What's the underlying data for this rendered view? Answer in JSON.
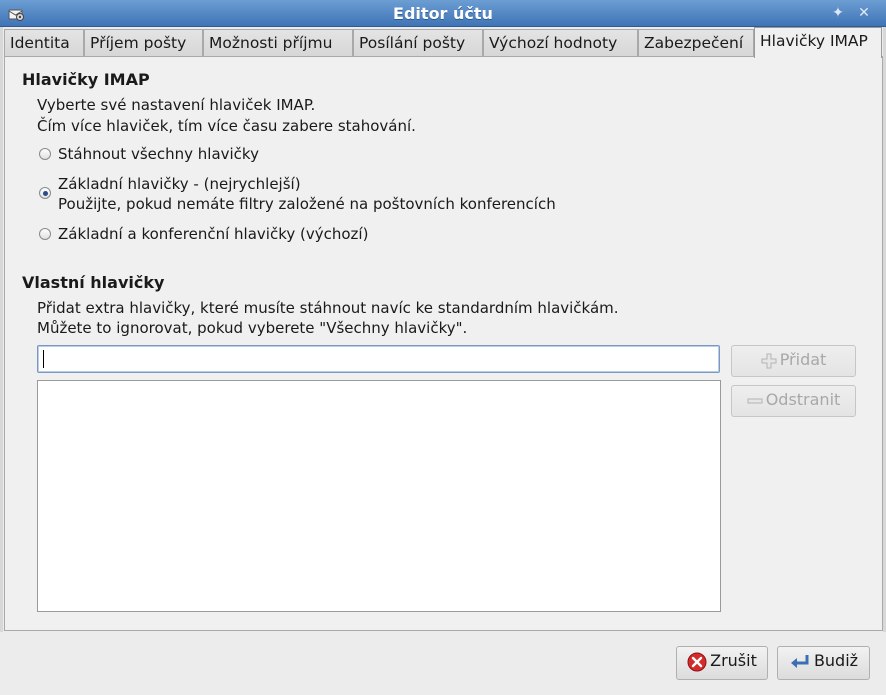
{
  "window": {
    "title": "Editor účtu",
    "pin_glyph": "✦",
    "close_glyph": "✕"
  },
  "tabs": [
    {
      "label": "Identita"
    },
    {
      "label": "Příjem pošty"
    },
    {
      "label": "Možnosti příjmu"
    },
    {
      "label": "Posílání pošty"
    },
    {
      "label": "Výchozí hodnoty"
    },
    {
      "label": "Zabezpečení"
    },
    {
      "label": "Hlavičky IMAP",
      "active": true
    }
  ],
  "imap_headers": {
    "heading": "Hlavičky IMAP",
    "description_line1": "Vyberte své nastavení hlaviček IMAP.",
    "description_line2": "Čím více hlaviček, tím více času zabere stahování.",
    "options": [
      {
        "label": "Stáhnout všechny hlavičky",
        "checked": false
      },
      {
        "label": "Základní hlavičky - (nejrychlejší)",
        "sublabel": "Použijte, pokud nemáte filtry založené na poštovních konferencích",
        "checked": true
      },
      {
        "label": "Základní a konferenční hlavičky (výchozí)",
        "checked": false
      }
    ]
  },
  "custom_headers": {
    "heading": "Vlastní hlavičky",
    "description_line1": "Přidat extra hlavičky, které musíte stáhnout navíc ke standardním hlavičkám.",
    "description_line2": "Můžete to ignorovat, pokud vyberete \"Všechny hlavičky\".",
    "input_value": "",
    "add_label": "Přidat",
    "remove_label": "Odstranit",
    "items": []
  },
  "footer": {
    "cancel_label": "Zrušit",
    "ok_label": "Budiž"
  },
  "colors": {
    "titlebar": "#4f84c2",
    "selection_focus": "#7c98c0",
    "cancel_icon": "#d62b2b",
    "ok_icon": "#3b6fb3"
  }
}
